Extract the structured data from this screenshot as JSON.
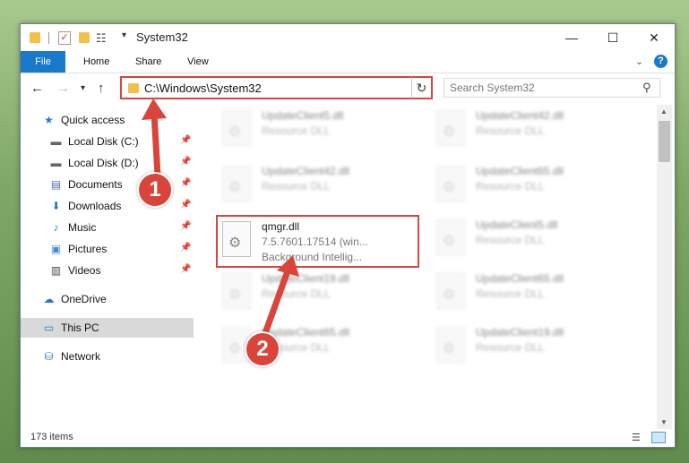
{
  "window": {
    "title": "System32",
    "controls": {
      "minimize": "—",
      "maximize": "☐",
      "close": "✕"
    }
  },
  "ribbon": {
    "tabs": [
      "File",
      "Home",
      "Share",
      "View"
    ]
  },
  "address": {
    "path": "C:\\Windows\\System32",
    "search_placeholder": "Search System32"
  },
  "nav": {
    "items": [
      {
        "label": "Quick access",
        "icon": "star-icon",
        "pinned": false
      },
      {
        "label": "Local Disk (C:)",
        "icon": "drive-icon",
        "pinned": true
      },
      {
        "label": "Local Disk (D:)",
        "icon": "drive-icon",
        "pinned": true
      },
      {
        "label": "Documents",
        "icon": "documents-icon",
        "pinned": true
      },
      {
        "label": "Downloads",
        "icon": "download-icon",
        "pinned": true
      },
      {
        "label": "Music",
        "icon": "music-icon",
        "pinned": true
      },
      {
        "label": "Pictures",
        "icon": "pictures-icon",
        "pinned": true
      },
      {
        "label": "Videos",
        "icon": "videos-icon",
        "pinned": true
      },
      {
        "label": "OneDrive",
        "icon": "cloud-icon",
        "pinned": false
      },
      {
        "label": "This PC",
        "icon": "computer-icon",
        "pinned": false
      },
      {
        "label": "Network",
        "icon": "network-icon",
        "pinned": false
      }
    ]
  },
  "files": {
    "left": [
      {
        "name": "UpdateClient5.dll",
        "type": "Resource DLL"
      },
      {
        "name": "UpdateClient42.dll",
        "type": "Resource DLL"
      },
      {
        "name": "qmgr.dll",
        "version": "7.5.7601.17514 (win...",
        "description": "Background Intellig..."
      },
      {
        "name": "UpdateClient19.dll",
        "type": "Resource DLL"
      },
      {
        "name": "UpdateClient65.dll",
        "type": "Resource DLL"
      }
    ],
    "right": [
      {
        "name": "UpdateClient42.dll",
        "type": "Resource DLL"
      },
      {
        "name": "UpdateClient65.dll",
        "type": "Resource DLL"
      },
      {
        "name": "UpdateClient5.dll",
        "type": "Resource DLL"
      },
      {
        "name": "UpdateClient65.dll",
        "type": "Resource DLL"
      },
      {
        "name": "UpdateClient19.dll",
        "type": "Resource DLL"
      }
    ]
  },
  "status": {
    "item_count": "173 items"
  },
  "annotations": {
    "step1": "1",
    "step2": "2",
    "color": "#d9453b"
  }
}
